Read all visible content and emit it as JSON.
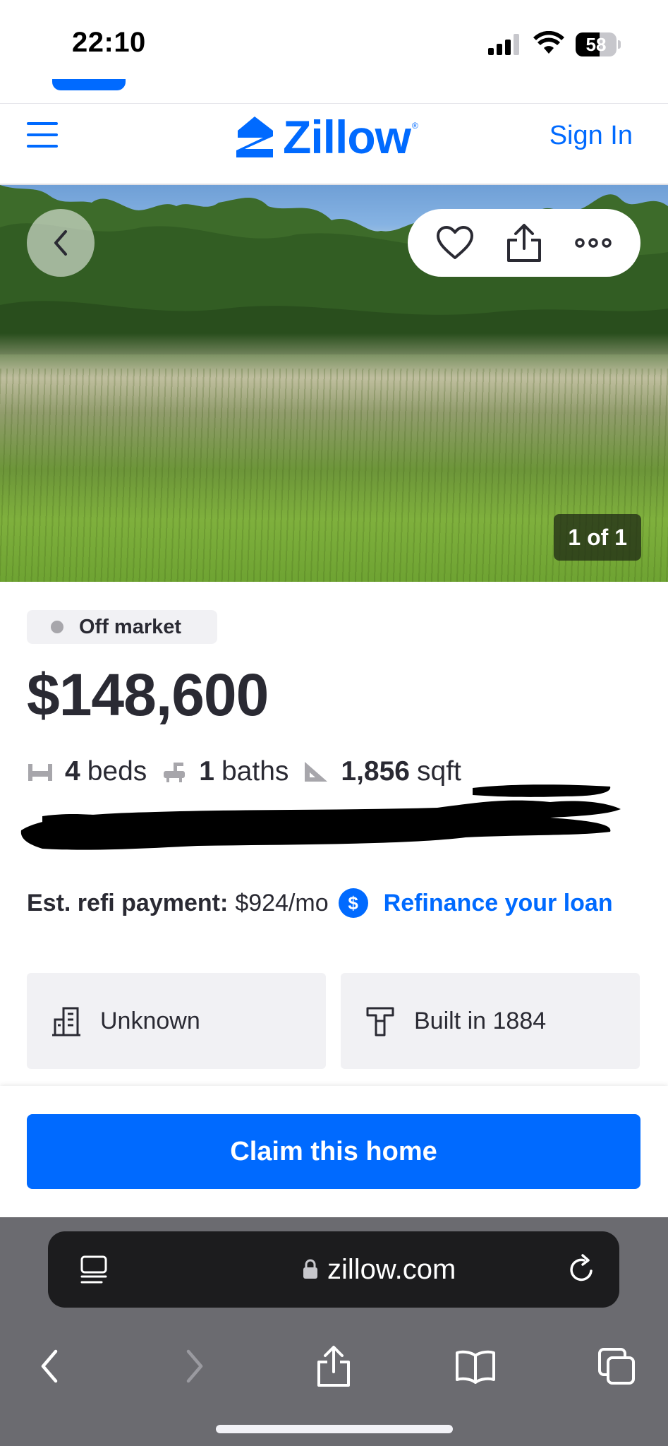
{
  "status_bar": {
    "time": "22:10",
    "battery": "58",
    "battery_level": 0.58
  },
  "header": {
    "logo_text": "Zillow",
    "sign_in_label": "Sign In"
  },
  "photo": {
    "counter": "1 of 1",
    "icons": [
      "chevron-left-icon",
      "heart-icon",
      "share-icon",
      "more-icon"
    ]
  },
  "listing": {
    "status": "Off market",
    "price": "$148,600",
    "beds_value": "4",
    "beds_unit": "beds",
    "baths_value": "1",
    "baths_unit": "baths",
    "sqft_value": "1,856",
    "sqft_unit": "sqft",
    "refi_label": "Est. refi payment:",
    "refi_value": "$924/mo",
    "refi_link": "Refinance your loan"
  },
  "fact_cards": [
    {
      "icon": "building-icon",
      "text": "Unknown"
    },
    {
      "icon": "hammer-icon",
      "text": "Built in 1884"
    }
  ],
  "cta": {
    "label": "Claim this home"
  },
  "browser": {
    "url": "zillow.com"
  },
  "colors": {
    "brand_blue": "#006aff",
    "text_dark": "#2a2a33",
    "badge_bg": "#f1f1f4"
  }
}
